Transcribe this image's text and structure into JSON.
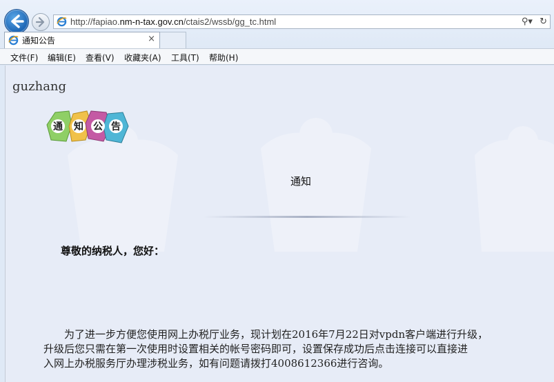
{
  "browser": {
    "url_prefix": "http://fapiao.",
    "url_host": "nm-n-tax.gov.cn",
    "url_path": "/ctais2/wssb/gg_tc.html",
    "tab_title": "通知公告",
    "tab_close": "×",
    "search_glyph": "⚲▾",
    "refresh_glyph": "↻"
  },
  "menu": {
    "file": "文件(F)",
    "edit": "编辑(E)",
    "view": "查看(V)",
    "favorites": "收藏夹(A)",
    "tools": "工具(T)",
    "help": "帮助(H)"
  },
  "page": {
    "user_name": "guzhang",
    "logo_chars": [
      "通",
      "知",
      "公",
      "告"
    ],
    "notice_title": "通知",
    "greeting": "尊敬的纳税人，您好：",
    "body_lines": [
      "　　为了进一步方便您使用网上办税厅业务，现计划在2016年7月22日对vpdn客户端进行升级，",
      "升级后您只需在第一次使用时设置相关的帐号密码即可，设置保存成功后点击连接可以直接进",
      "入网上办税服务厅办理涉税业务，如有问题请拨打4008612366进行咨询。"
    ]
  },
  "colors": {
    "page_bg": "#e7ecf7",
    "chrome_bg": "#dbe6f4",
    "back_button": "#1b64b4"
  }
}
